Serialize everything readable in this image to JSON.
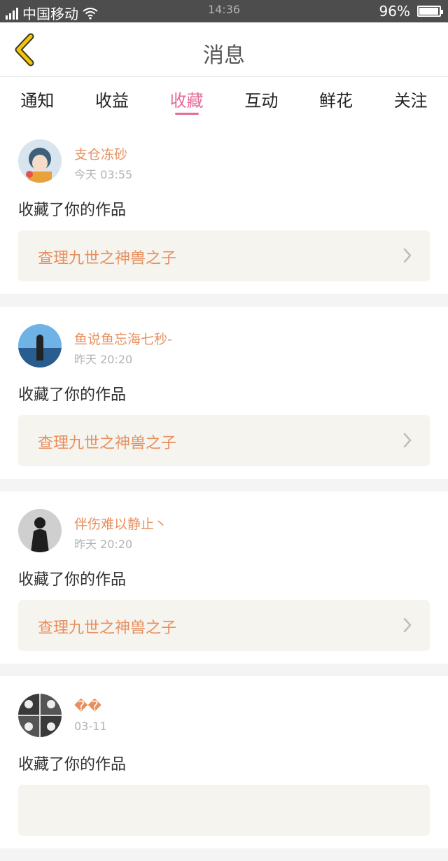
{
  "status": {
    "carrier": "中国移动",
    "time": "14:36",
    "battery": "96%",
    "battery_level": 0.96,
    "network": "4G"
  },
  "header": {
    "title": "消息"
  },
  "tabs": [
    {
      "label": "通知"
    },
    {
      "label": "收益"
    },
    {
      "label": "收藏"
    },
    {
      "label": "互动"
    },
    {
      "label": "鲜花"
    },
    {
      "label": "关注"
    }
  ],
  "active_tab": "收藏",
  "colors": {
    "accent_pink": "#e56b99",
    "name_orange": "#e88f5e",
    "back_yellow": "#f2c40f"
  },
  "messages": [
    {
      "user": "支仓冻砂",
      "time": "今天 03:55",
      "action": "收藏了你的作品",
      "work": "查理九世之神兽之子"
    },
    {
      "user": "鱼说鱼忘海七秒-",
      "time": "昨天 20:20",
      "action": "收藏了你的作品",
      "work": "查理九世之神兽之子"
    },
    {
      "user": "伴伤难以静止丶",
      "time": "昨天 20:20",
      "action": "收藏了你的作品",
      "work": "查理九世之神兽之子"
    },
    {
      "user": "��",
      "time": "03-11",
      "action": "收藏了你的作品",
      "work": ""
    }
  ]
}
